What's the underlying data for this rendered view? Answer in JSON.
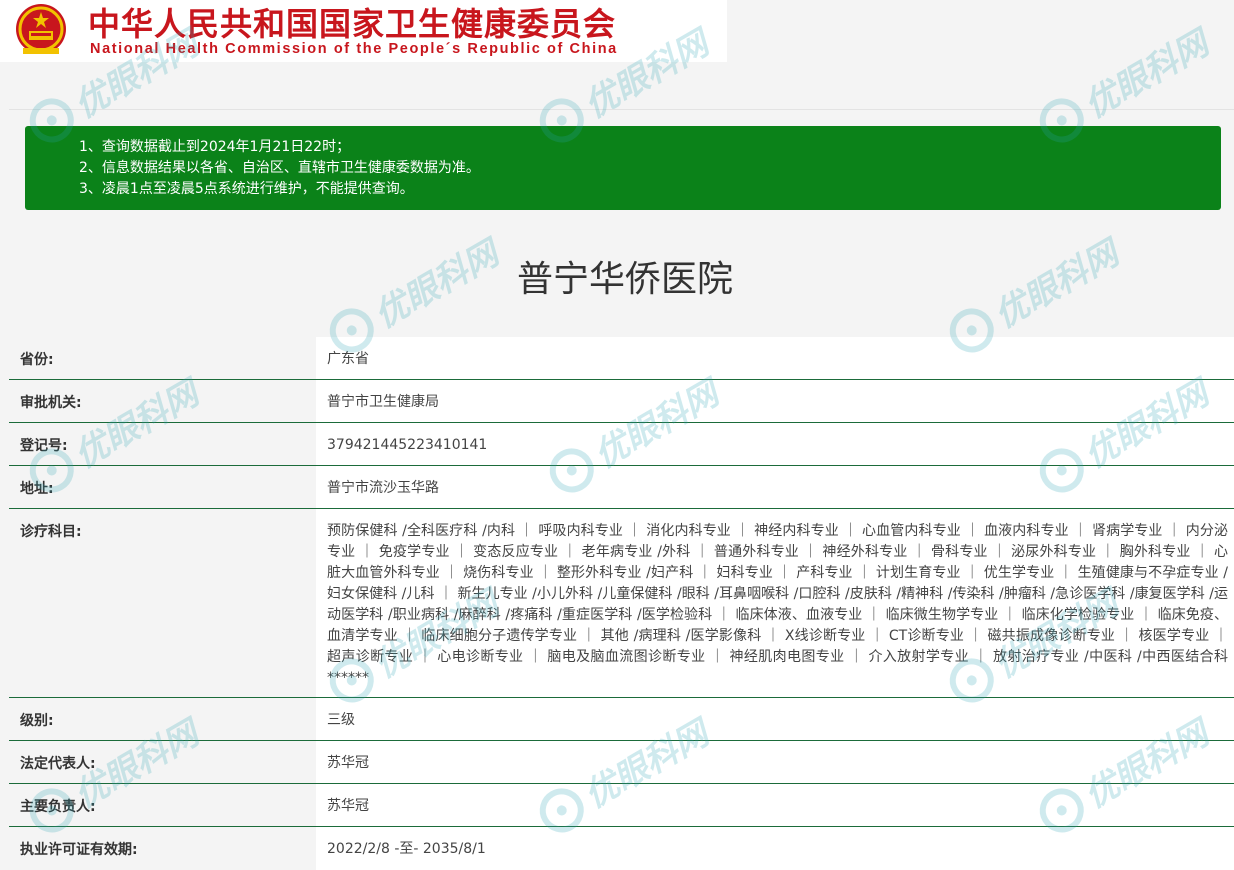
{
  "header": {
    "title_cn": "中华人民共和国国家卫生健康委员会",
    "title_en": "National Health Commission of the People´s Republic of China",
    "emblem_icon": "national-emblem-icon",
    "brand_color": "#c8161d"
  },
  "notice": {
    "background": "#0b8219",
    "lines": [
      "1、查询数据截止到2024年1月21日22时；",
      "2、信息数据结果以各省、自治区、直辖市卫生健康委数据为准。",
      "3、凌晨1点至凌晨5点系统进行维护，不能提供查询。"
    ]
  },
  "hospital_name": "普宁华侨医院",
  "details": [
    {
      "label": "省份:",
      "value": "广东省"
    },
    {
      "label": "审批机关:",
      "value": "普宁市卫生健康局"
    },
    {
      "label": "登记号:",
      "value": "379421445223410141"
    },
    {
      "label": "地址:",
      "value": "普宁市流沙玉华路"
    },
    {
      "label": "诊疗科目:",
      "value": "预防保健科 /全科医疗科 /内科 ｜ 呼吸内科专业 ｜ 消化内科专业 ｜ 神经内科专业 ｜ 心血管内科专业 ｜ 血液内科专业 ｜ 肾病学专业 ｜ 内分泌专业 ｜ 免疫学专业 ｜ 变态反应专业 ｜ 老年病专业 /外科 ｜ 普通外科专业 ｜ 神经外科专业 ｜ 骨科专业 ｜ 泌尿外科专业 ｜ 胸外科专业 ｜ 心脏大血管外科专业 ｜ 烧伤科专业 ｜ 整形外科专业 /妇产科 ｜ 妇科专业 ｜ 产科专业 ｜ 计划生育专业 ｜ 优生学专业 ｜ 生殖健康与不孕症专业 /妇女保健科 /儿科 ｜ 新生儿专业 /小儿外科 /儿童保健科 /眼科 /耳鼻咽喉科 /口腔科 /皮肤科 /精神科 /传染科 /肿瘤科 /急诊医学科 /康复医学科 /运动医学科 /职业病科 /麻醉科 /疼痛科 /重症医学科 /医学检验科 ｜ 临床体液、血液专业 ｜ 临床微生物学专业 ｜ 临床化学检验专业 ｜ 临床免疫、血清学专业 ｜ 临床细胞分子遗传学专业 ｜ 其他 /病理科 /医学影像科 ｜ X线诊断专业 ｜ CT诊断专业 ｜ 磁共振成像诊断专业 ｜ 核医学专业 ｜ 超声诊断专业 ｜ 心电诊断专业 ｜ 脑电及脑血流图诊断专业 ｜ 神经肌肉电图专业 ｜ 介入放射学专业 ｜ 放射治疗专业 /中医科 /中西医结合科******"
    },
    {
      "label": "级别:",
      "value": "三级"
    },
    {
      "label": "法定代表人:",
      "value": "苏华冠"
    },
    {
      "label": "主要负责人:",
      "value": "苏华冠"
    },
    {
      "label": "执业许可证有效期:",
      "value": "2022/2/8 -至- 2035/8/1"
    }
  ],
  "watermark": {
    "text": "优眼科网",
    "icon": "eye-logo-icon",
    "color": "#2aa4b5"
  }
}
